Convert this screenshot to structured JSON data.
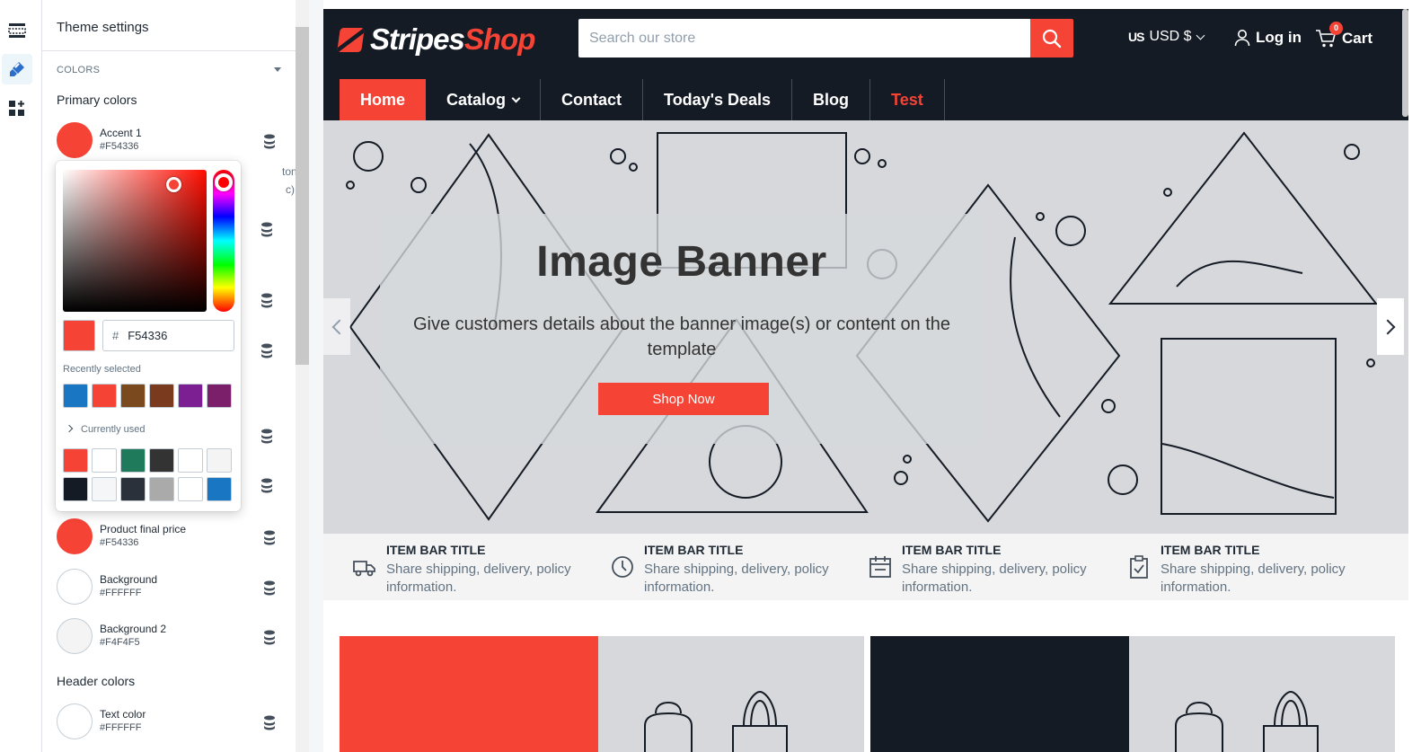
{
  "colors": {
    "accent": "#F54336",
    "header_bg": "#141b25",
    "banner_bg": "#d6d8db"
  },
  "rail": {
    "icons": [
      "sections-icon",
      "theme-brush-icon",
      "apps-icon"
    ]
  },
  "panel": {
    "title": "Theme settings",
    "section": "COLORS",
    "primary_label": "Primary colors",
    "header_colors_label": "Header colors",
    "hidden_text_1": "ton",
    "hidden_text_2": "c).",
    "accent1": {
      "name": "Accent 1",
      "hex": "#F54336",
      "color": "#F54336"
    },
    "product_final_price": {
      "name": "Product final price",
      "hex": "#F54336",
      "color": "#F54336"
    },
    "background": {
      "name": "Background",
      "hex": "#FFFFFF",
      "color": "#FFFFFF"
    },
    "background2": {
      "name": "Background 2",
      "hex": "#F4F4F5",
      "color": "#F4F4F5"
    },
    "text_color": {
      "name": "Text color",
      "hex": "#FFFFFF",
      "color": "#FFFFFF"
    }
  },
  "picker": {
    "hash": "#",
    "value": "F54336",
    "recent_label": "Recently selected",
    "recent": [
      "#1976c2",
      "#F54336",
      "#7a4a1e",
      "#7a3a1e",
      "#7b1f93",
      "#7c1f6b"
    ],
    "current_label": "Currently used",
    "current_row1": [
      "#F54336",
      "#ffffff",
      "#1e7a5a",
      "#333333",
      "#ffffff",
      "#f4f4f5"
    ],
    "current_row2": [
      "#141b25",
      "#f4f6f8",
      "#2a313b",
      "#aaaaaa",
      "#ffffff",
      "#1976c2"
    ]
  },
  "store": {
    "logo_a": "Stripes",
    "logo_b": "Shop",
    "search_placeholder": "Search our store",
    "currency_flag": "US",
    "currency": "USD $",
    "login": "Log in",
    "cart": "Cart",
    "cart_count": "0",
    "nav": [
      {
        "label": "Home"
      },
      {
        "label": "Catalog"
      },
      {
        "label": "Contact"
      },
      {
        "label": "Today's Deals"
      },
      {
        "label": "Blog"
      },
      {
        "label": "Test"
      }
    ],
    "banner": {
      "title": "Image Banner",
      "text": "Give customers details about the banner image(s) or content on the template",
      "button": "Shop Now"
    },
    "info_items": [
      {
        "title": "ITEM BAR TITLE",
        "text": "Share shipping, delivery, policy information.",
        "icon": "truck-icon"
      },
      {
        "title": "ITEM BAR TITLE",
        "text": "Share shipping, delivery, policy information.",
        "icon": "clock-icon"
      },
      {
        "title": "ITEM BAR TITLE",
        "text": "Share shipping, delivery, policy information.",
        "icon": "calendar-icon"
      },
      {
        "title": "ITEM BAR TITLE",
        "text": "Share shipping, delivery, policy information.",
        "icon": "clipboard-check-icon"
      }
    ],
    "promo_colors": [
      "#F54336",
      "#141b25"
    ]
  }
}
